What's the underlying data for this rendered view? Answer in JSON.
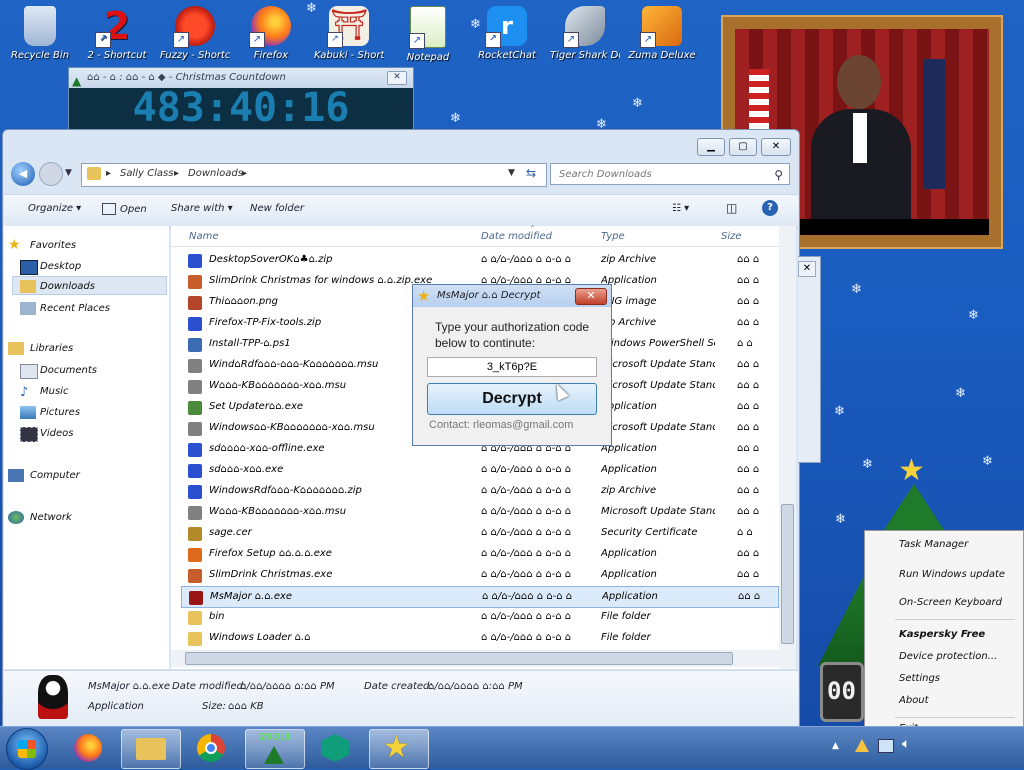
{
  "countdown": {
    "title": "⌂⌂ - ⌂ : ⌂⌂ - ⌂ ◆ - Christmas Countdown",
    "digits": "483:40:16"
  },
  "desktop_icons": [
    {
      "label": "Recycle Bin",
      "icon": "recycle-bin-icon"
    },
    {
      "label": "2 - Shortcut",
      "icon": "number-two-icon"
    },
    {
      "label": "Fuzzy - Shortcut",
      "icon": "red-fuzzball-icon"
    },
    {
      "label": "Firefox",
      "icon": "firefox-icon"
    },
    {
      "label": "Kabuki - Shortcut",
      "icon": "torii-gate-icon"
    },
    {
      "label": "Notepad",
      "icon": "notepad-icon"
    },
    {
      "label": "RocketChat",
      "icon": "chat-bubble-icon"
    },
    {
      "label": "Tiger Shark Deluxe",
      "icon": "shark-icon"
    },
    {
      "label": "Zuma Deluxe",
      "icon": "zuma-icon"
    }
  ],
  "explorer": {
    "breadcrumb": [
      "Sally Class",
      "Downloads"
    ],
    "search_placeholder": "Search Downloads",
    "toolbar": {
      "organize": "Organize",
      "open": "Open",
      "share_with": "Share with",
      "new_folder": "New folder"
    },
    "nav": {
      "favorites": "Favorites",
      "desktop": "Desktop",
      "downloads": "Downloads",
      "recent_places": "Recent Places",
      "libraries": "Libraries",
      "documents": "Documents",
      "music": "Music",
      "pictures": "Pictures",
      "videos": "Videos",
      "computer": "Computer",
      "network": "Network"
    },
    "columns": {
      "name": "Name",
      "date": "Date modified",
      "type": "Type",
      "size": "Size"
    },
    "files": [
      {
        "name": "DesktopSoverOK⌂♣⌂.zip",
        "date": "⌂ ⌂/⌂-/⌂⌂⌂ ⌂ ⌂-⌂ ⌂",
        "type": "zip Archive",
        "size": "⌂⌂ ⌂",
        "color": "#2b4fd1"
      },
      {
        "name": "SlimDrink Christmas for windows ⌂.⌂.zip.exe",
        "date": "⌂ ⌂/⌂-/⌂⌂⌂ ⌂ ⌂-⌂ ⌂",
        "type": "Application",
        "size": "⌂⌂ ⌂",
        "color": "#c75d2b"
      },
      {
        "name": "Thi⌂⌂⌂on.png",
        "date": "⌂ ⌂/⌂-/⌂⌂⌂ ⌂ ⌂-⌂ ⌂",
        "type": "PNG image",
        "size": "⌂⌂ ⌂",
        "color": "#b3462a"
      },
      {
        "name": "Firefox-TP-Fix-tools.zip",
        "date": "⌂ ⌂/⌂-/⌂⌂⌂ ⌂ ⌂-⌂ ⌂",
        "type": "zip Archive",
        "size": "⌂⌂ ⌂",
        "color": "#2b4fd1"
      },
      {
        "name": "Install-TPP-⌂.ps1",
        "date": "⌂ ⌂/⌂-/⌂⌂⌂ ⌂ ⌂-⌂ ⌂",
        "type": "Windows PowerShell Script",
        "size": "⌂ ⌂",
        "color": "#3b6bb3"
      },
      {
        "name": "Wind⌂Rdf⌂⌂⌂-⌂⌂⌂-K⌂⌂⌂⌂⌂⌂⌂.msu",
        "date": "⌂ ⌂/⌂-/⌂⌂⌂ ⌂ ⌂-⌂ ⌂",
        "type": "Microsoft Update Standalone",
        "size": "⌂⌂ ⌂",
        "color": "#808080"
      },
      {
        "name": "W⌂⌂⌂-KB⌂⌂⌂⌂⌂⌂⌂-x⌂⌂.msu",
        "date": "⌂ ⌂/⌂-/⌂⌂⌂ ⌂ ⌂-⌂ ⌂",
        "type": "Microsoft Update Standalone",
        "size": "⌂⌂ ⌂",
        "color": "#808080"
      },
      {
        "name": "Set Updater⌂⌂.exe",
        "date": "⌂ ⌂/⌂-/⌂⌂⌂ ⌂ ⌂-⌂ ⌂",
        "type": "Application",
        "size": "⌂⌂ ⌂",
        "color": "#4a8a3a"
      },
      {
        "name": "Windows⌂⌂-KB⌂⌂⌂⌂⌂⌂⌂-x⌂⌂.msu",
        "date": "⌂ ⌂/⌂-/⌂⌂⌂ ⌂ ⌂-⌂ ⌂",
        "type": "Microsoft Update Standalone",
        "size": "⌂⌂ ⌂",
        "color": "#808080"
      },
      {
        "name": "sd⌂⌂⌂⌂-x⌂⌂-offline.exe",
        "date": "⌂ ⌂/⌂-/⌂⌂⌂ ⌂ ⌂-⌂ ⌂",
        "type": "Application",
        "size": "⌂⌂ ⌂",
        "color": "#2b4fd1"
      },
      {
        "name": "sd⌂⌂⌂-x⌂⌂.exe",
        "date": "⌂ ⌂/⌂-/⌂⌂⌂ ⌂ ⌂-⌂ ⌂",
        "type": "Application",
        "size": "⌂⌂ ⌂",
        "color": "#2b4fd1"
      },
      {
        "name": "WindowsRdf⌂⌂⌂-K⌂⌂⌂⌂⌂⌂⌂.zip",
        "date": "⌂ ⌂/⌂-/⌂⌂⌂ ⌂ ⌂-⌂ ⌂",
        "type": "zip Archive",
        "size": "⌂⌂ ⌂",
        "color": "#2b4fd1"
      },
      {
        "name": "W⌂⌂⌂-KB⌂⌂⌂⌂⌂⌂⌂-x⌂⌂.msu",
        "date": "⌂ ⌂/⌂-/⌂⌂⌂ ⌂ ⌂-⌂ ⌂",
        "type": "Microsoft Update Standalone",
        "size": "⌂⌂ ⌂",
        "color": "#808080"
      },
      {
        "name": "sage.cer",
        "date": "⌂ ⌂/⌂-/⌂⌂⌂ ⌂ ⌂-⌂ ⌂",
        "type": "Security Certificate",
        "size": "⌂ ⌂",
        "color": "#b38a2a"
      },
      {
        "name": "Firefox Setup ⌂⌂.⌂.⌂.exe",
        "date": "⌂ ⌂/⌂-/⌂⌂⌂ ⌂ ⌂-⌂ ⌂",
        "type": "Application",
        "size": "⌂⌂ ⌂",
        "color": "#e06a1c"
      },
      {
        "name": "SlimDrink Christmas.exe",
        "date": "⌂ ⌂/⌂-/⌂⌂⌂ ⌂ ⌂-⌂ ⌂",
        "type": "Application",
        "size": "⌂⌂ ⌂",
        "color": "#c75d2b"
      },
      {
        "name": "MsMajor ⌂.⌂.exe",
        "date": "⌂ ⌂/⌂-/⌂⌂⌂ ⌂ ⌂-⌂ ⌂",
        "type": "Application",
        "size": "⌂⌂ ⌂",
        "color": "#9a1515",
        "selected": true
      },
      {
        "name": "bin",
        "date": "⌂ ⌂/⌂-/⌂⌂⌂ ⌂ ⌂-⌂ ⌂",
        "type": "File folder",
        "size": "",
        "color": "#e8c25a",
        "folder": true
      },
      {
        "name": "Windows Loader ⌂.⌂",
        "date": "⌂ ⌂/⌂-/⌂⌂⌂ ⌂ ⌂-⌂ ⌂",
        "type": "File folder",
        "size": "",
        "color": "#e8c25a",
        "folder": true
      }
    ],
    "details": {
      "name": "MsMajor ⌂.⌂.exe",
      "type": "Application",
      "date_modified_label": "Date modified:",
      "date_modified": "⌂/⌂⌂/⌂⌂⌂⌂ ⌂:⌂⌂ PM",
      "date_created_label": "Date created:",
      "date_created": "⌂/⌂⌂/⌂⌂⌂⌂ ⌂:⌂⌂ PM",
      "size_label": "Size:",
      "size": "⌂⌂⌂ KB"
    }
  },
  "dialog": {
    "title": "MsMajor ⌂.⌂ Decrypt",
    "prompt": "Type your authorization code below to continute:",
    "code_value": "3_kT6p?E",
    "decrypt_label": "Decrypt",
    "contact": "Contact: rleomas@gmail.com"
  },
  "context_menu": {
    "items": [
      "Task Manager",
      "Run Windows update",
      "On-Screen Keyboard",
      "Kaspersky Free",
      "Device protection...",
      "Settings",
      "About",
      "Exit"
    ]
  },
  "taskbar": {
    "gadget_value": "293:3",
    "clock_partial": "00"
  },
  "colors": {
    "desktop_blue": "#1f63c4",
    "selection": "#dcebfb",
    "decrypt_border": "#3c7fb1",
    "close_red": "#c2402a"
  }
}
